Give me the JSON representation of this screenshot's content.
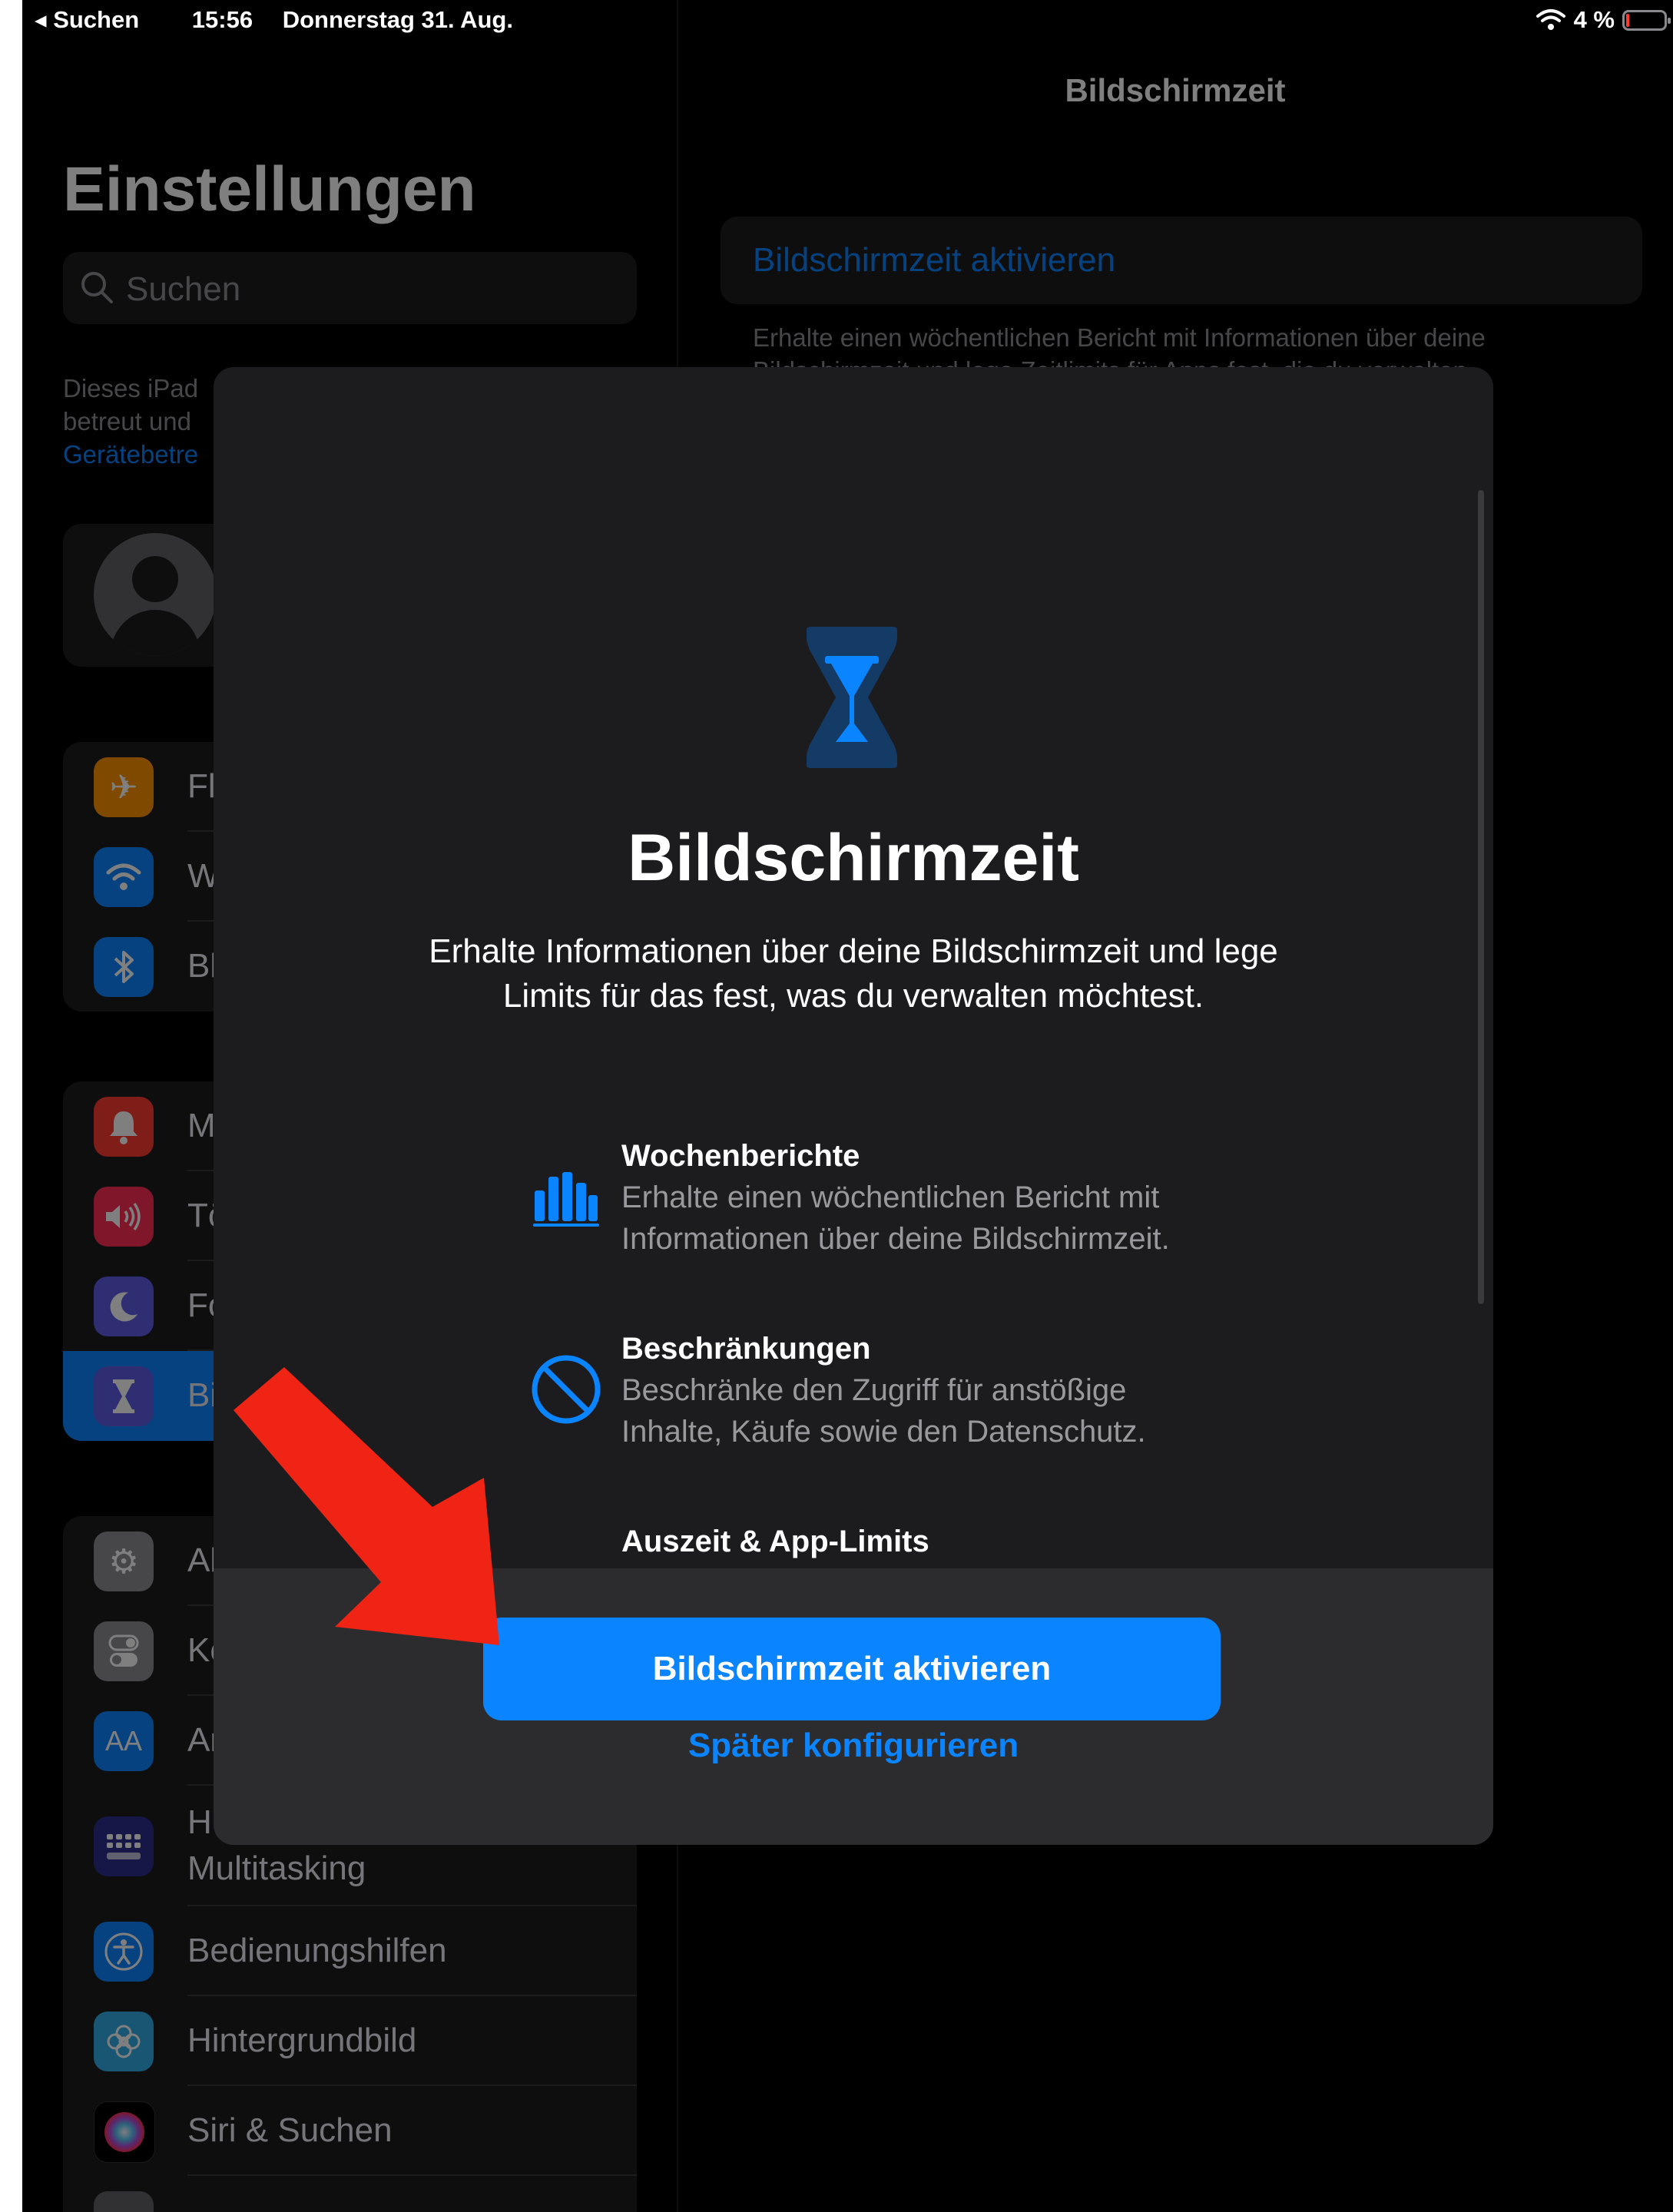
{
  "status_bar": {
    "back_label": "Suchen",
    "time": "15:56",
    "date": "Donnerstag 31. Aug.",
    "battery": "4 %"
  },
  "sidebar": {
    "title": "Einstellungen",
    "search_placeholder": "Suchen",
    "note_line1": "Dieses iPad",
    "note_line2": "betreut und",
    "note_link": "Gerätebetre",
    "group1": [
      {
        "label": "Fl",
        "icon": "airplane-icon",
        "color": "#ff9500"
      },
      {
        "label": "W",
        "icon": "wifi-icon",
        "color": "#0a84ff"
      },
      {
        "label": "Bl",
        "icon": "bluetooth-icon",
        "color": "#0a84ff"
      }
    ],
    "group2": [
      {
        "label": "M",
        "icon": "bell-icon",
        "color": "#ff3b30"
      },
      {
        "label": "Tö",
        "icon": "speaker-icon",
        "color": "#ff2d55"
      },
      {
        "label": "Fo",
        "icon": "moon-icon",
        "color": "#5e5ce6"
      },
      {
        "label": "Bi",
        "icon": "hourglass-icon",
        "color": "#5e5ce6"
      }
    ],
    "group3": [
      {
        "label": "Al",
        "icon": "gear-icon",
        "color": "#8e8e93"
      },
      {
        "label": "Ko",
        "icon": "toggles-icon",
        "color": "#8e8e93"
      },
      {
        "label": "An",
        "icon": "text-size-icon",
        "color": "#0a84ff"
      },
      {
        "label_line1": "H",
        "label_line2": "Multitasking",
        "icon": "home-grid-icon",
        "color": "#0a84ff"
      },
      {
        "label": "Bedienungshilfen",
        "icon": "accessibility-icon",
        "color": "#0a84ff"
      },
      {
        "label": "Hintergrundbild",
        "icon": "flower-icon",
        "color": "#32ade6"
      },
      {
        "label": "Siri & Suchen",
        "icon": "siri-icon",
        "color": "#000000"
      }
    ]
  },
  "detail": {
    "title": "Bildschirmzeit",
    "cell_label": "Bildschirmzeit aktivieren",
    "footer_line1": "Erhalte einen wöchentlichen Bericht mit Informationen über deine",
    "footer_line2": "Bildschirmzeit und lege Zeitlimits für Apps fest, die du verwalten"
  },
  "modal": {
    "title": "Bildschirmzeit",
    "description_line1": "Erhalte Informationen über deine Bildschirmzeit und lege",
    "description_line2": "Limits für das fest, was du verwalten möchtest.",
    "features": [
      {
        "heading": "Wochenberichte",
        "line1": "Erhalte einen wöchentlichen Bericht mit",
        "line2": "Informationen über deine Bildschirmzeit.",
        "icon": "bar-chart-icon"
      },
      {
        "heading": "Beschränkungen",
        "line1": "Beschränke den Zugriff für anstößige",
        "line2": "Inhalte, Käufe sowie den Datenschutz.",
        "icon": "prohibited-icon"
      },
      {
        "heading": "Auszeit & App-Limits"
      }
    ],
    "primary_button": "Bildschirmzeit aktivieren",
    "secondary_button": "Später konfigurieren"
  },
  "colors": {
    "accent": "#0a84ff",
    "annotation_arrow": "#ef2414"
  }
}
